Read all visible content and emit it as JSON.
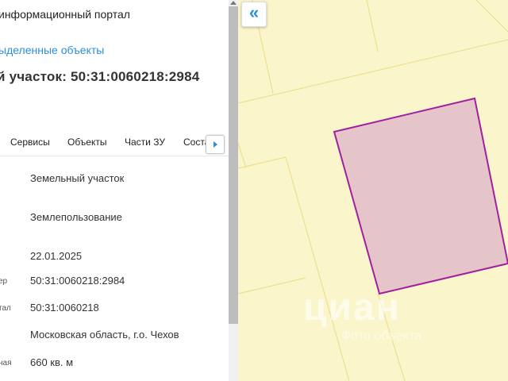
{
  "sidebar": {
    "portal_title": "информационный портал",
    "selected_objects_link": "ыделенные объекты",
    "parcel_title": "й участок: 50:31:0060218:2984",
    "tabs": [
      {
        "label": "Сервисы"
      },
      {
        "label": "Объекты"
      },
      {
        "label": "Части ЗУ"
      },
      {
        "label": "Соста"
      }
    ],
    "rows": [
      {
        "label": "",
        "value": "Земельный участок"
      },
      {
        "label": "",
        "value": "Землепользование"
      },
      {
        "label": "",
        "value": "22.01.2025"
      },
      {
        "label": "ер",
        "value": "50:31:0060218:2984"
      },
      {
        "label": "тал",
        "value": "50:31:0060218"
      },
      {
        "label": "",
        "value": "Московская область, г.о. Чехов"
      },
      {
        "label": "ная",
        "value": "660 кв. м"
      }
    ]
  },
  "map": {
    "collapse_icon": "«",
    "background_color": "#fbf5cb",
    "parcel_outline_color": "#a020a0",
    "parcel_fill_color": "#e5c5c9",
    "boundary_line_color": "#ece08e",
    "watermark_logo_text": "циан",
    "watermark_logo_subtext": "Фото объекта"
  }
}
